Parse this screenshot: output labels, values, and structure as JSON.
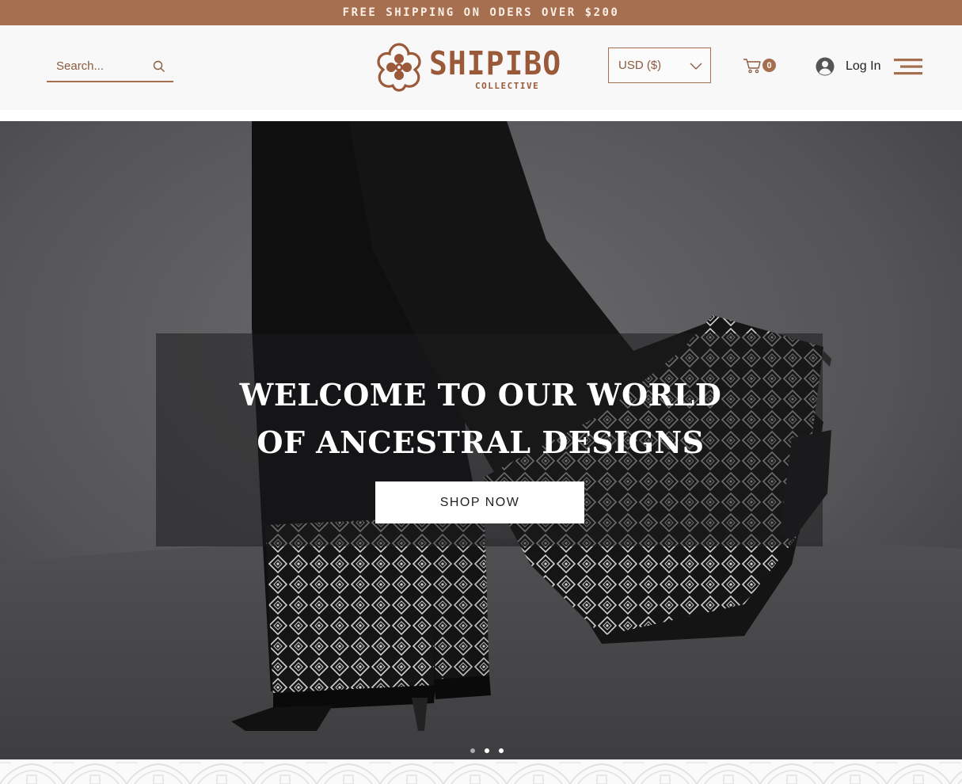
{
  "promo": {
    "text": "FREE SHIPPING ON ODERS OVER $200"
  },
  "header": {
    "search": {
      "placeholder": "Search..."
    },
    "logo": {
      "name": "SHIPIBO",
      "sub": "COLLECTIVE"
    },
    "currency": {
      "selected": "USD ($)"
    },
    "cart": {
      "count": "0"
    },
    "login": {
      "label": "Log In"
    }
  },
  "hero": {
    "title_line1": "WELCOME TO OUR WORLD",
    "title_line2": "OF ANCESTRAL DESIGNS",
    "cta": "SHOP NOW",
    "slides": {
      "count": 3,
      "active": 1
    }
  },
  "colors": {
    "brand": "#a66f4f",
    "brand_dark": "#9a5a3a",
    "header_bg": "#f8f8f8",
    "overlay": "rgba(28,28,30,0.55)"
  },
  "icons": [
    "search-icon",
    "chevron-down-icon",
    "cart-icon",
    "avatar-icon",
    "menu-icon",
    "logo-flower-icon"
  ]
}
